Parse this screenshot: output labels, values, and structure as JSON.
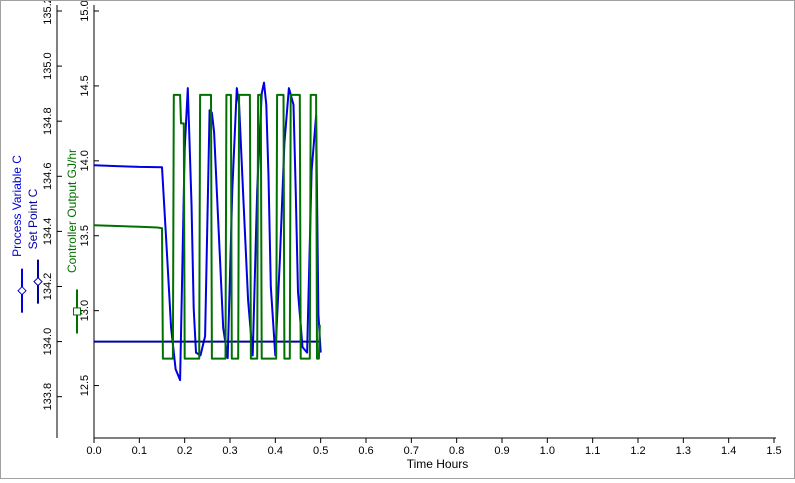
{
  "chart_data": {
    "type": "line",
    "xlabel": "Time Hours",
    "x_ticks": [
      "0.0",
      "0.1",
      "0.2",
      "0.3",
      "0.4",
      "0.5",
      "0.6",
      "0.7",
      "0.8",
      "0.9",
      "1.0",
      "1.1",
      "1.2",
      "1.3",
      "1.4",
      "1.5"
    ],
    "xlim": [
      0,
      1.5
    ],
    "left_axis": {
      "labels": [
        "Process Variable C",
        "Set Point C"
      ],
      "ylim": [
        133.65,
        135.2
      ],
      "ticks": [
        "133.8",
        "134.0",
        "134.2",
        "134.4",
        "134.6",
        "134.8",
        "135.0",
        "135.2"
      ]
    },
    "right_axis": {
      "label": "Controller Output GJ/hr",
      "ylim": [
        12.15,
        15.0
      ],
      "ticks": [
        "12.5",
        "13.0",
        "13.5",
        "14.0",
        "14.5",
        "15.0"
      ]
    },
    "series": [
      {
        "name": "Process Variable C",
        "axis": "left",
        "color": "#0000e0",
        "marker": "diamond",
        "x": [
          0,
          0.05,
          0.1,
          0.15,
          0.16,
          0.17,
          0.18,
          0.19,
          0.2,
          0.207,
          0.215,
          0.22,
          0.225,
          0.235,
          0.245,
          0.255,
          0.26,
          0.265,
          0.275,
          0.285,
          0.295,
          0.305,
          0.315,
          0.32,
          0.33,
          0.34,
          0.35,
          0.36,
          0.37,
          0.375,
          0.38,
          0.385,
          0.39,
          0.4,
          0.41,
          0.42,
          0.43,
          0.44,
          0.445,
          0.45,
          0.46,
          0.47,
          0.48,
          0.49,
          0.495,
          0.5
        ],
        "y": [
          134.64,
          134.637,
          134.634,
          134.633,
          134.35,
          134.05,
          133.9,
          133.86,
          134.7,
          134.92,
          134.5,
          134.12,
          133.96,
          133.95,
          134.02,
          134.84,
          134.83,
          134.76,
          134.4,
          134.05,
          133.94,
          134.55,
          134.92,
          134.86,
          134.5,
          134.15,
          133.95,
          134.55,
          134.9,
          134.94,
          134.86,
          134.6,
          134.2,
          133.95,
          134.3,
          134.72,
          134.92,
          134.86,
          134.55,
          134.18,
          133.98,
          133.96,
          134.62,
          134.82,
          134.1,
          133.96
        ]
      },
      {
        "name": "Set Point C",
        "axis": "left",
        "color": "#0000a0",
        "marker": "diamond",
        "x": [
          0,
          0.5
        ],
        "y": [
          134.0,
          134.0
        ]
      },
      {
        "name": "Controller Output GJ/hr",
        "axis": "right",
        "color": "#007000",
        "marker": "square",
        "x": [
          0,
          0.05,
          0.1,
          0.14,
          0.15,
          0.152,
          0.174,
          0.176,
          0.19,
          0.192,
          0.198,
          0.2,
          0.232,
          0.234,
          0.248,
          0.25,
          0.258,
          0.26,
          0.29,
          0.292,
          0.302,
          0.304,
          0.318,
          0.32,
          0.344,
          0.346,
          0.36,
          0.362,
          0.368,
          0.37,
          0.402,
          0.404,
          0.418,
          0.42,
          0.432,
          0.434,
          0.454,
          0.456,
          0.476,
          0.478,
          0.49,
          0.492,
          0.496,
          0.498,
          0.5
        ],
        "y": [
          13.57,
          13.565,
          13.56,
          13.555,
          13.55,
          12.68,
          12.68,
          14.44,
          14.44,
          14.25,
          14.25,
          12.68,
          12.68,
          14.44,
          14.44,
          14.44,
          14.44,
          12.68,
          12.68,
          14.44,
          14.44,
          12.68,
          12.68,
          14.44,
          14.44,
          12.68,
          12.68,
          14.44,
          14.44,
          12.68,
          12.68,
          14.44,
          14.44,
          12.68,
          12.68,
          14.44,
          14.44,
          12.68,
          12.68,
          14.44,
          14.44,
          12.68,
          12.68,
          12.9,
          12.9
        ]
      }
    ],
    "grid": false,
    "legend": "left vertical"
  }
}
